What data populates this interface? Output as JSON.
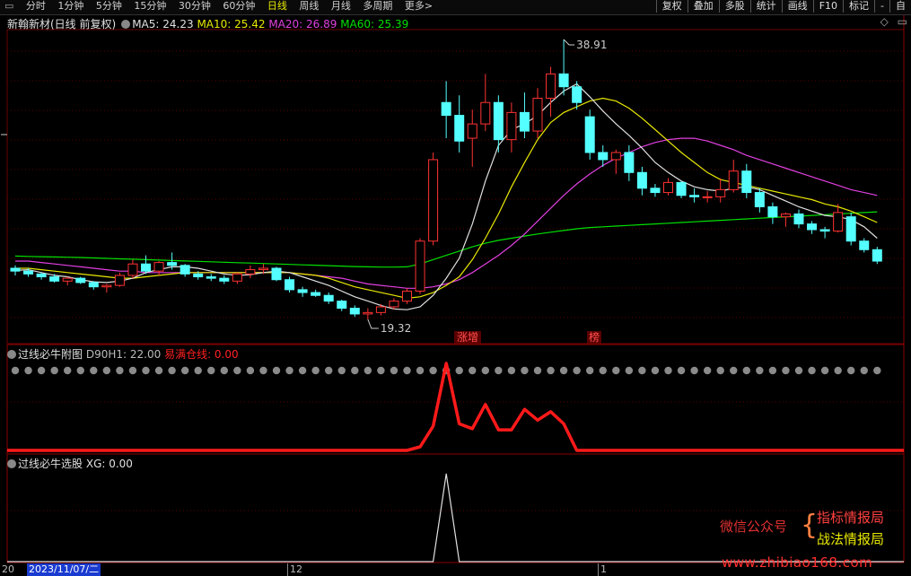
{
  "toolbar": {
    "items": [
      "分时",
      "1分钟",
      "5分钟",
      "15分钟",
      "30分钟",
      "60分钟",
      "日线",
      "周线",
      "月线",
      "多周期",
      "更多>"
    ],
    "active": "日线",
    "right_buttons": [
      "复权",
      "叠加",
      "多股",
      "统计",
      "画线",
      "F10",
      "标记",
      "-",
      "自"
    ]
  },
  "main": {
    "stock_name": "新翰新材(日线 前复权)",
    "ma5": "MA5: 24.23",
    "ma10": "MA10: 25.42",
    "ma20": "MA20: 26.89",
    "ma60": "MA60: 25.39",
    "high_label": "38.91",
    "low_label": "19.32",
    "tag1": "涨增",
    "tag2": "榜",
    "colors": {
      "ma5": "#e0e0e0",
      "ma10": "#e8e800",
      "ma20": "#e040e0",
      "ma60": "#00e000",
      "up": "#ff3232",
      "down": "#54ffff"
    }
  },
  "panel1": {
    "title": "过线必牛附图",
    "d90": "D90H1: 22.00",
    "yiman": "易满仓线: 0.00"
  },
  "panel2": {
    "title": "过线必牛选股",
    "xg": "XG: 0.00"
  },
  "date_axis": {
    "left": "20",
    "date": "2023/11/07/二",
    "month": "12",
    "marker": "1"
  },
  "watermark": {
    "line1": "微信公众号",
    "line2a": "指标情报局",
    "line2b": "战法情报局",
    "site": "www.zhibiao168.com"
  },
  "chart_data": {
    "type": "candlestick",
    "high": 38.91,
    "low": 19.32,
    "candles": [
      [
        22.9,
        23.1,
        22.4,
        22.7
      ],
      [
        22.7,
        22.9,
        22.3,
        22.5
      ],
      [
        22.5,
        22.6,
        22.1,
        22.3
      ],
      [
        22.3,
        22.5,
        21.9,
        22.0
      ],
      [
        22.0,
        22.3,
        21.7,
        22.2
      ],
      [
        22.2,
        22.3,
        21.8,
        21.9
      ],
      [
        21.9,
        22.0,
        21.4,
        21.6
      ],
      [
        21.6,
        21.8,
        21.2,
        21.7
      ],
      [
        21.7,
        22.6,
        21.6,
        22.4
      ],
      [
        22.4,
        23.5,
        22.2,
        23.2
      ],
      [
        23.2,
        23.8,
        22.5,
        22.7
      ],
      [
        22.7,
        23.4,
        22.4,
        23.3
      ],
      [
        23.3,
        24.0,
        22.8,
        23.1
      ],
      [
        23.1,
        23.2,
        22.3,
        22.5
      ],
      [
        22.5,
        22.7,
        22.1,
        22.3
      ],
      [
        22.3,
        22.5,
        22.0,
        22.2
      ],
      [
        22.2,
        22.4,
        21.8,
        22.0
      ],
      [
        22.0,
        22.6,
        21.8,
        22.5
      ],
      [
        22.5,
        23.1,
        22.2,
        22.8
      ],
      [
        22.8,
        23.2,
        22.5,
        22.9
      ],
      [
        22.9,
        23.0,
        22.0,
        22.1
      ],
      [
        22.1,
        22.3,
        21.2,
        21.4
      ],
      [
        21.4,
        21.6,
        20.9,
        21.2
      ],
      [
        21.2,
        21.4,
        20.9,
        21.0
      ],
      [
        21.0,
        21.2,
        20.4,
        20.6
      ],
      [
        20.6,
        20.7,
        19.9,
        20.1
      ],
      [
        20.1,
        20.3,
        19.5,
        19.7
      ],
      [
        19.7,
        20.1,
        19.3,
        19.8
      ],
      [
        19.8,
        20.4,
        19.6,
        20.2
      ],
      [
        20.2,
        20.8,
        20.0,
        20.6
      ],
      [
        20.6,
        21.5,
        20.4,
        21.3
      ],
      [
        21.3,
        25.0,
        21.1,
        24.8
      ],
      [
        24.8,
        31.0,
        24.5,
        30.5
      ],
      [
        34.5,
        36.0,
        32.0,
        33.6
      ],
      [
        33.6,
        35.0,
        31.0,
        31.8
      ],
      [
        32.0,
        34.0,
        30.0,
        33.0
      ],
      [
        33.0,
        36.5,
        32.5,
        34.5
      ],
      [
        34.5,
        35.0,
        31.0,
        31.9
      ],
      [
        31.9,
        34.5,
        31.0,
        33.8
      ],
      [
        33.8,
        35.2,
        32.0,
        32.5
      ],
      [
        32.5,
        35.5,
        32.0,
        34.8
      ],
      [
        34.8,
        37.0,
        33.5,
        36.5
      ],
      [
        36.5,
        38.91,
        35.0,
        35.6
      ],
      [
        35.6,
        36.0,
        34.0,
        34.5
      ],
      [
        33.5,
        34.0,
        30.5,
        31.0
      ],
      [
        31.0,
        31.5,
        30.0,
        30.5
      ],
      [
        30.5,
        31.2,
        29.5,
        31.0
      ],
      [
        31.0,
        31.5,
        29.0,
        29.6
      ],
      [
        29.6,
        30.0,
        28.0,
        28.5
      ],
      [
        28.5,
        28.8,
        27.9,
        28.2
      ],
      [
        28.2,
        29.2,
        28.0,
        28.9
      ],
      [
        28.9,
        29.0,
        27.8,
        28.0
      ],
      [
        28.0,
        28.5,
        27.5,
        27.9
      ],
      [
        27.9,
        28.3,
        27.5,
        27.9
      ],
      [
        27.9,
        29.2,
        27.5,
        28.4
      ],
      [
        28.4,
        30.5,
        28.2,
        29.7
      ],
      [
        29.7,
        30.2,
        27.8,
        28.2
      ],
      [
        28.2,
        28.5,
        26.8,
        27.2
      ],
      [
        27.2,
        27.5,
        26.0,
        26.5
      ],
      [
        26.5,
        26.8,
        25.8,
        26.7
      ],
      [
        26.7,
        27.0,
        25.7,
        26.0
      ],
      [
        26.0,
        26.2,
        25.3,
        25.6
      ],
      [
        25.6,
        25.8,
        25.0,
        25.5
      ],
      [
        25.5,
        27.4,
        25.4,
        26.8
      ],
      [
        26.5,
        26.8,
        24.5,
        24.8
      ],
      [
        24.8,
        25.0,
        24.0,
        24.2
      ],
      [
        24.2,
        24.4,
        23.2,
        23.4
      ]
    ],
    "ma5": [
      22.75,
      22.8,
      22.6,
      22.4,
      22.3,
      22.1,
      21.95,
      21.9,
      22.0,
      22.2,
      22.6,
      22.8,
      23.0,
      23.0,
      22.9,
      22.7,
      22.5,
      22.4,
      22.45,
      22.6,
      22.7,
      22.6,
      22.3,
      22.0,
      21.7,
      21.3,
      20.9,
      20.6,
      20.3,
      20.05,
      20.0,
      20.2,
      21.0,
      22.2,
      23.6,
      26.0,
      29.0,
      31.5,
      32.6,
      33.0,
      33.6,
      34.5,
      35.3,
      35.8,
      34.9,
      33.9,
      33.0,
      32.2,
      31.3,
      30.3,
      29.6,
      29.0,
      28.6,
      28.4,
      28.3,
      28.5,
      28.6,
      28.4,
      28.0,
      27.6,
      27.2,
      26.9,
      26.6,
      26.5,
      26.3,
      25.8,
      25.0
    ],
    "ma10": [
      22.9,
      22.9,
      22.8,
      22.7,
      22.6,
      22.5,
      22.4,
      22.3,
      22.2,
      22.2,
      22.3,
      22.4,
      22.5,
      22.6,
      22.6,
      22.6,
      22.6,
      22.6,
      22.6,
      22.6,
      22.6,
      22.6,
      22.5,
      22.4,
      22.2,
      21.9,
      21.6,
      21.4,
      21.2,
      21.0,
      20.8,
      20.9,
      21.2,
      21.7,
      22.3,
      23.5,
      25.0,
      26.7,
      28.6,
      30.3,
      31.9,
      33.1,
      33.8,
      34.2,
      34.6,
      34.8,
      34.6,
      34.1,
      33.4,
      32.6,
      31.8,
      31.0,
      30.3,
      29.6,
      29.1,
      28.9,
      28.7,
      28.5,
      28.3,
      28.1,
      27.9,
      27.7,
      27.4,
      27.2,
      26.9,
      26.5,
      26.1
    ],
    "ma20": [
      23.4,
      23.4,
      23.3,
      23.2,
      23.1,
      23.0,
      22.9,
      22.8,
      22.7,
      22.7,
      22.6,
      22.6,
      22.6,
      22.6,
      22.6,
      22.6,
      22.6,
      22.6,
      22.6,
      22.6,
      22.6,
      22.6,
      22.5,
      22.4,
      22.3,
      22.2,
      22.0,
      21.8,
      21.7,
      21.6,
      21.5,
      21.5,
      21.6,
      21.8,
      22.1,
      22.6,
      23.2,
      23.8,
      24.5,
      25.3,
      26.2,
      27.1,
      28.0,
      28.8,
      29.5,
      30.1,
      30.6,
      31.0,
      31.4,
      31.7,
      31.9,
      32.0,
      32.0,
      31.8,
      31.5,
      31.2,
      30.8,
      30.5,
      30.2,
      29.9,
      29.6,
      29.3,
      29.0,
      28.7,
      28.4,
      28.2,
      28.0
    ],
    "ma60": [
      23.75,
      23.73,
      23.71,
      23.69,
      23.67,
      23.65,
      23.62,
      23.59,
      23.56,
      23.53,
      23.5,
      23.47,
      23.44,
      23.41,
      23.38,
      23.35,
      23.32,
      23.29,
      23.26,
      23.23,
      23.2,
      23.17,
      23.14,
      23.11,
      23.08,
      23.05,
      23.02,
      23.0,
      22.98,
      22.98,
      23.0,
      23.2,
      23.5,
      23.8,
      24.1,
      24.4,
      24.65,
      24.85,
      25.0,
      25.15,
      25.3,
      25.42,
      25.54,
      25.66,
      25.75,
      25.8,
      25.85,
      25.9,
      25.95,
      26.0,
      26.05,
      26.1,
      26.15,
      26.2,
      26.25,
      26.3,
      26.35,
      26.4,
      26.45,
      26.5,
      26.55,
      26.6,
      26.65,
      26.7,
      26.75,
      26.8,
      26.85
    ],
    "panel1_values": [
      0,
      0,
      0,
      0,
      0,
      0,
      0,
      0,
      0,
      0,
      0,
      0,
      0,
      0,
      0,
      0,
      0,
      0,
      0,
      0,
      0,
      0,
      0,
      0,
      0,
      0,
      0,
      0,
      0,
      0,
      0,
      3,
      20,
      72,
      22,
      18,
      38,
      17,
      17,
      34,
      25,
      32,
      22,
      0,
      0,
      0,
      0,
      0,
      0,
      0,
      0,
      0,
      0,
      0,
      0,
      0,
      0,
      0,
      0,
      0,
      0,
      0,
      0,
      0,
      0,
      0,
      0
    ],
    "panel2_values": [
      0,
      0,
      0,
      0,
      0,
      0,
      0,
      0,
      0,
      0,
      0,
      0,
      0,
      0,
      0,
      0,
      0,
      0,
      0,
      0,
      0,
      0,
      0,
      0,
      0,
      0,
      0,
      0,
      0,
      0,
      0,
      0,
      0,
      1,
      0,
      0,
      0,
      0,
      0,
      0,
      0,
      0,
      0,
      0,
      0,
      0,
      0,
      0,
      0,
      0,
      0,
      0,
      0,
      0,
      0,
      0,
      0,
      0,
      0,
      0,
      0,
      0,
      0,
      0,
      0,
      0,
      0
    ]
  }
}
